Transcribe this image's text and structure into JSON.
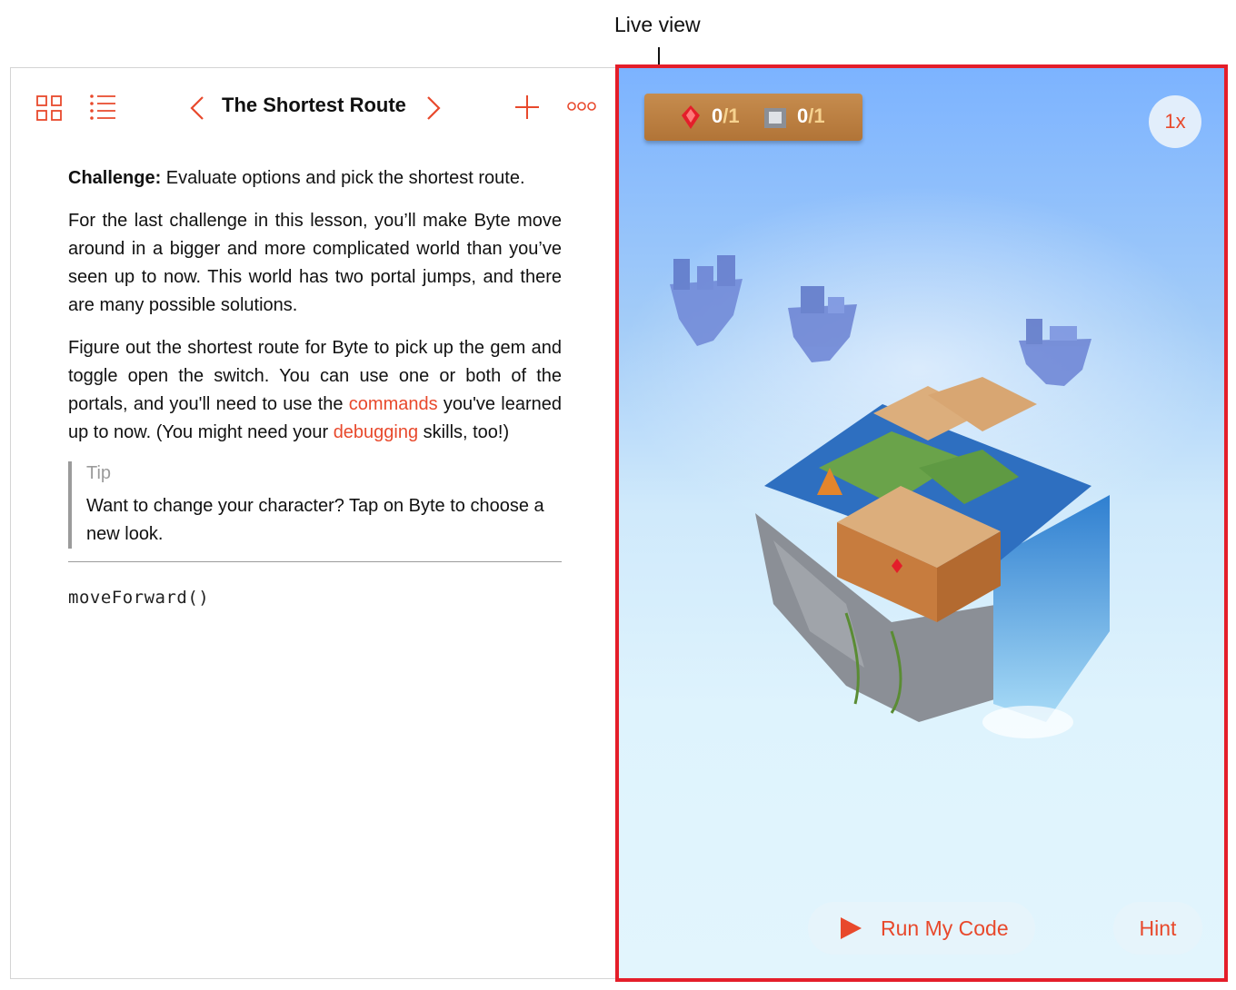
{
  "callout": {
    "label": "Live view"
  },
  "toolbar": {
    "title": "The Shortest Route"
  },
  "content": {
    "challenge_label": "Challenge:",
    "challenge_text": " Evaluate options and pick the shortest route.",
    "paragraph1": "For the last challenge in this lesson, you’ll make Byte move around in a bigger and more complicated world than you’ve seen up to now. This world has two portal jumps, and there are many possible solutions.",
    "p2_part1": "Figure out the shortest route for Byte to pick up the gem and toggle open the switch. You can use one or both of the portals, and you'll need to use the ",
    "p2_link1": "commands",
    "p2_part2": " you've learned up to now. (You might need your ",
    "p2_link2": "debugging",
    "p2_part3": " skills, too!)",
    "tip_label": "Tip",
    "tip_text": "Want to change your character? Tap on Byte to choose a new look.",
    "code": "moveForward()"
  },
  "live_view": {
    "gems_collected": "0",
    "gems_total": "/1",
    "switches_toggled": "0",
    "switches_total": "/1",
    "speed_label": "1x",
    "run_label": "Run My Code",
    "hint_label": "Hint"
  },
  "colors": {
    "accent": "#e8492c",
    "live_border": "#e41e2a"
  },
  "icons": [
    "grid-icon",
    "list-icon",
    "chevron-left-icon",
    "chevron-right-icon",
    "plus-icon",
    "more-icon",
    "gem-icon",
    "switch-icon",
    "play-icon"
  ]
}
